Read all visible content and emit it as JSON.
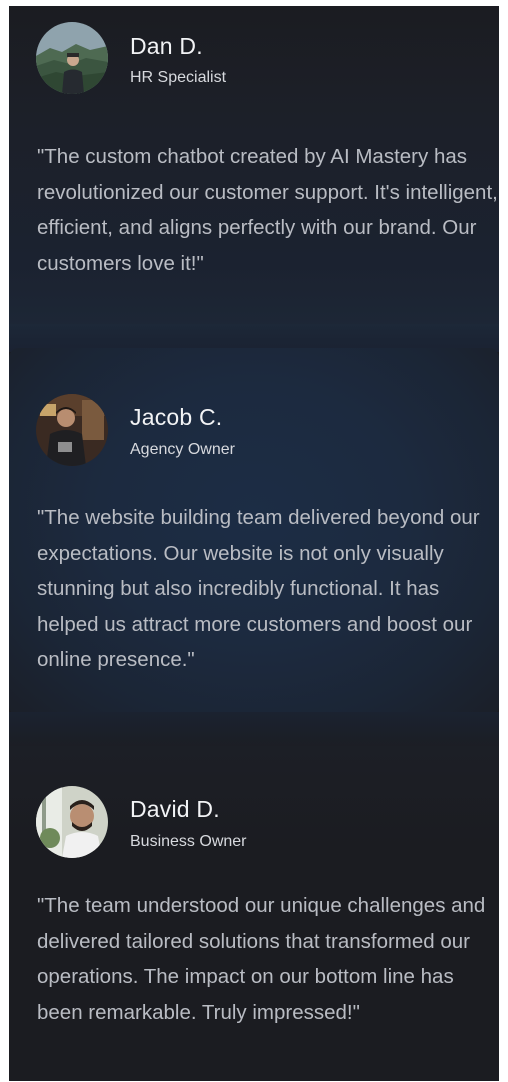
{
  "testimonials": [
    {
      "name": "Dan D.",
      "role": "HR Specialist",
      "quote": "\"The custom chatbot created by AI Mastery has revolutionized our customer support. It's intelligent, efficient, and aligns perfectly with our brand. Our customers love it!\"",
      "avatar_icon": "avatar-photo-mountains"
    },
    {
      "name": "Jacob C.",
      "role": "Agency Owner",
      "quote": "\"The website building team delivered beyond our expectations. Our website is not only visually stunning but also incredibly functional. It has helped us attract more customers and boost our online presence.\"",
      "avatar_icon": "avatar-photo-cafe"
    },
    {
      "name": "David D.",
      "role": "Business Owner",
      "quote": "\"The team understood our unique challenges and delivered tailored solutions that transformed our operations. The impact on our bottom line has been remarkable. Truly impressed!\"",
      "avatar_icon": "avatar-photo-portrait"
    }
  ],
  "colors": {
    "background": "#1b1c21",
    "highlight_card": "#1c2d45",
    "name_text": "#f2f3f5",
    "quote_text": "#b9bcc3"
  }
}
